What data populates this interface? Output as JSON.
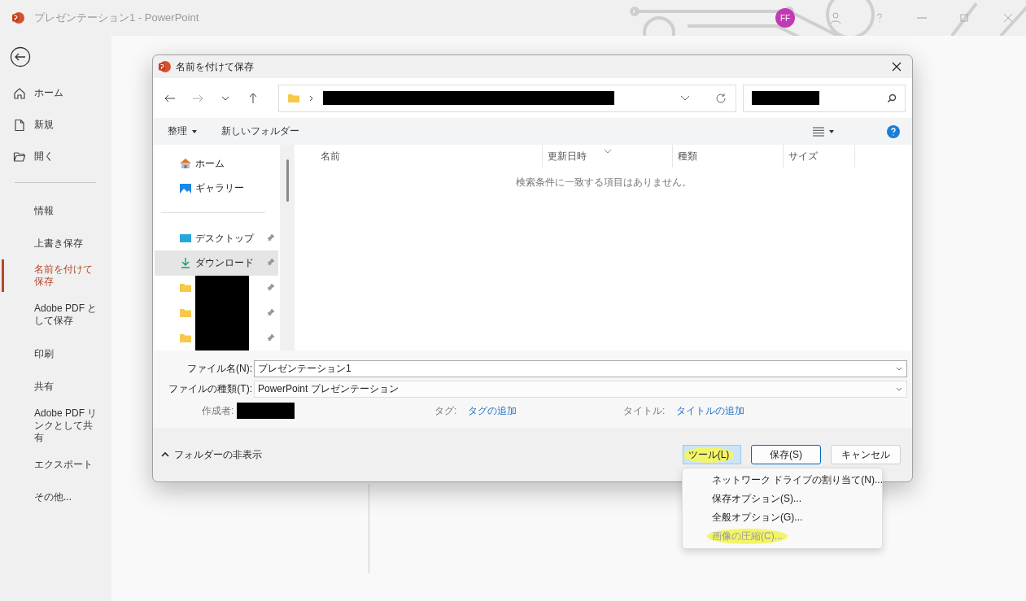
{
  "window": {
    "title": "プレゼンテーション1",
    "app": "PowerPoint",
    "separator": "-",
    "avatar": "FF"
  },
  "sidebar": {
    "top_items": [
      {
        "label": "ホーム"
      },
      {
        "label": "新規"
      },
      {
        "label": "開く"
      }
    ],
    "items": [
      {
        "label": "情報",
        "selected": false
      },
      {
        "label": "上書き保存",
        "selected": false
      },
      {
        "label": "名前を付けて保存",
        "selected": true
      },
      {
        "label": "Adobe PDF として保存",
        "selected": false
      },
      {
        "label": "印刷",
        "selected": false
      },
      {
        "label": "共有",
        "selected": false
      },
      {
        "label": "Adobe PDF リンクとして共有",
        "selected": false
      },
      {
        "label": "エクスポート",
        "selected": false
      },
      {
        "label": "その他...",
        "selected": false
      }
    ]
  },
  "dialog": {
    "title": "名前を付けて保存",
    "toolbar": {
      "organize": "整理",
      "new_folder": "新しいフォルダー"
    },
    "nav_pane": {
      "quick": [
        {
          "label": "ホーム",
          "selected": false
        },
        {
          "label": "ギャラリー",
          "selected": false
        }
      ],
      "pinned": [
        {
          "label": "デスクトップ",
          "selected": false
        },
        {
          "label": "ダウンロード",
          "selected": true
        },
        {
          "kind": "redacted",
          "selected": false
        },
        {
          "kind": "redacted",
          "selected": false
        },
        {
          "kind": "redacted",
          "selected": false
        }
      ]
    },
    "columns": [
      "名前",
      "更新日時",
      "種類",
      "サイズ"
    ],
    "empty_message": "検索条件に一致する項目はありません。",
    "file_name": {
      "label": "ファイル名(N):",
      "value": "プレゼンテーション1"
    },
    "file_type": {
      "label": "ファイルの種類(T):",
      "value": "PowerPoint プレゼンテーション"
    },
    "meta": [
      {
        "label": "作成者:",
        "kind": "redacted"
      },
      {
        "label": "タグ:",
        "link": "タグの追加"
      },
      {
        "label": "タイトル:",
        "link": "タイトルの追加"
      }
    ],
    "hide_folders": "フォルダーの非表示",
    "buttons": {
      "tools": {
        "label": "ツール(L)",
        "highlighted": true
      },
      "save": "保存(S)",
      "cancel": "キャンセル"
    },
    "tools_menu": [
      {
        "label": "ネットワーク ドライブの割り当て(N)...",
        "disabled": false,
        "highlighted": false
      },
      {
        "label": "保存オプション(S)...",
        "disabled": false,
        "highlighted": false
      },
      {
        "label": "全般オプション(G)...",
        "disabled": false,
        "highlighted": false
      },
      {
        "label": "画像の圧縮(C)...",
        "disabled": true,
        "highlighted": true
      }
    ]
  }
}
